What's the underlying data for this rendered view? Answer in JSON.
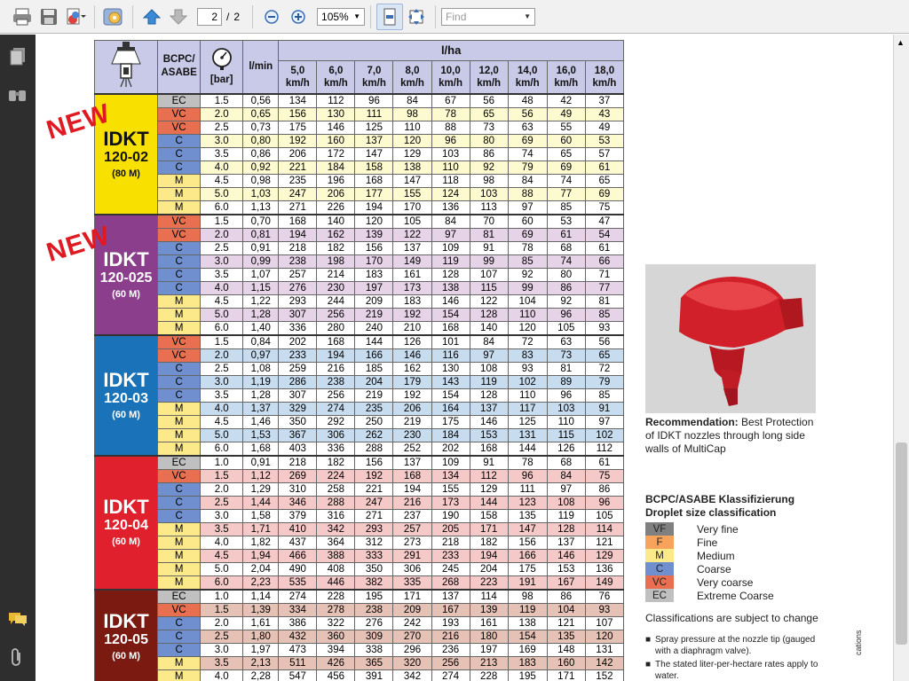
{
  "toolbar": {
    "page_current": "2",
    "page_sep": "/",
    "page_total": "2",
    "zoom": "105%",
    "find_placeholder": "Find"
  },
  "table": {
    "header_lha": "l/ha",
    "col_class": "BCPC/ ASABE",
    "col_bar": "[bar]",
    "col_lmin": "l/min",
    "speeds": [
      [
        "5,0",
        "km/h"
      ],
      [
        "6,0",
        "km/h"
      ],
      [
        "7,0",
        "km/h"
      ],
      [
        "8,0",
        "km/h"
      ],
      [
        "10,0",
        "km/h"
      ],
      [
        "12,0",
        "km/h"
      ],
      [
        "14,0",
        "km/h"
      ],
      [
        "16,0",
        "km/h"
      ],
      [
        "18,0",
        "km/h"
      ]
    ],
    "groups": [
      {
        "name1": "IDKT",
        "name2": "120-02",
        "name3": "(80 M)",
        "color": "#f8e000",
        "textcolor": "#111",
        "rowcolor": "#fdfad0",
        "rows": [
          [
            "EC",
            "1.5",
            "0,56",
            "134",
            "112",
            "96",
            "84",
            "67",
            "56",
            "48",
            "42",
            "37"
          ],
          [
            "VC",
            "2.0",
            "0,65",
            "156",
            "130",
            "111",
            "98",
            "78",
            "65",
            "56",
            "49",
            "43"
          ],
          [
            "VC",
            "2.5",
            "0,73",
            "175",
            "146",
            "125",
            "110",
            "88",
            "73",
            "63",
            "55",
            "49"
          ],
          [
            "C",
            "3.0",
            "0,80",
            "192",
            "160",
            "137",
            "120",
            "96",
            "80",
            "69",
            "60",
            "53"
          ],
          [
            "C",
            "3.5",
            "0,86",
            "206",
            "172",
            "147",
            "129",
            "103",
            "86",
            "74",
            "65",
            "57"
          ],
          [
            "C",
            "4.0",
            "0,92",
            "221",
            "184",
            "158",
            "138",
            "110",
            "92",
            "79",
            "69",
            "61"
          ],
          [
            "M",
            "4.5",
            "0,98",
            "235",
            "196",
            "168",
            "147",
            "118",
            "98",
            "84",
            "74",
            "65"
          ],
          [
            "M",
            "5.0",
            "1,03",
            "247",
            "206",
            "177",
            "155",
            "124",
            "103",
            "88",
            "77",
            "69"
          ],
          [
            "M",
            "6.0",
            "1,13",
            "271",
            "226",
            "194",
            "170",
            "136",
            "113",
            "97",
            "85",
            "75"
          ]
        ]
      },
      {
        "name1": "IDKT",
        "name2": "120-025",
        "name3": "(60 M)",
        "color": "#8b3e8c",
        "textcolor": "#fff",
        "rowcolor": "#e7d3e7",
        "rows": [
          [
            "VC",
            "1.5",
            "0,70",
            "168",
            "140",
            "120",
            "105",
            "84",
            "70",
            "60",
            "53",
            "47"
          ],
          [
            "VC",
            "2.0",
            "0,81",
            "194",
            "162",
            "139",
            "122",
            "97",
            "81",
            "69",
            "61",
            "54"
          ],
          [
            "C",
            "2.5",
            "0,91",
            "218",
            "182",
            "156",
            "137",
            "109",
            "91",
            "78",
            "68",
            "61"
          ],
          [
            "C",
            "3.0",
            "0,99",
            "238",
            "198",
            "170",
            "149",
            "119",
            "99",
            "85",
            "74",
            "66"
          ],
          [
            "C",
            "3.5",
            "1,07",
            "257",
            "214",
            "183",
            "161",
            "128",
            "107",
            "92",
            "80",
            "71"
          ],
          [
            "C",
            "4.0",
            "1,15",
            "276",
            "230",
            "197",
            "173",
            "138",
            "115",
            "99",
            "86",
            "77"
          ],
          [
            "M",
            "4.5",
            "1,22",
            "293",
            "244",
            "209",
            "183",
            "146",
            "122",
            "104",
            "92",
            "81"
          ],
          [
            "M",
            "5.0",
            "1,28",
            "307",
            "256",
            "219",
            "192",
            "154",
            "128",
            "110",
            "96",
            "85"
          ],
          [
            "M",
            "6.0",
            "1,40",
            "336",
            "280",
            "240",
            "210",
            "168",
            "140",
            "120",
            "105",
            "93"
          ]
        ]
      },
      {
        "name1": "IDKT",
        "name2": "120-03",
        "name3": "(60 M)",
        "color": "#1a73b8",
        "textcolor": "#fff",
        "rowcolor": "#c8dcf0",
        "rows": [
          [
            "VC",
            "1.5",
            "0,84",
            "202",
            "168",
            "144",
            "126",
            "101",
            "84",
            "72",
            "63",
            "56"
          ],
          [
            "VC",
            "2.0",
            "0,97",
            "233",
            "194",
            "166",
            "146",
            "116",
            "97",
            "83",
            "73",
            "65"
          ],
          [
            "C",
            "2.5",
            "1,08",
            "259",
            "216",
            "185",
            "162",
            "130",
            "108",
            "93",
            "81",
            "72"
          ],
          [
            "C",
            "3.0",
            "1,19",
            "286",
            "238",
            "204",
            "179",
            "143",
            "119",
            "102",
            "89",
            "79"
          ],
          [
            "C",
            "3.5",
            "1,28",
            "307",
            "256",
            "219",
            "192",
            "154",
            "128",
            "110",
            "96",
            "85"
          ],
          [
            "M",
            "4.0",
            "1,37",
            "329",
            "274",
            "235",
            "206",
            "164",
            "137",
            "117",
            "103",
            "91"
          ],
          [
            "M",
            "4.5",
            "1,46",
            "350",
            "292",
            "250",
            "219",
            "175",
            "146",
            "125",
            "110",
            "97"
          ],
          [
            "M",
            "5.0",
            "1,53",
            "367",
            "306",
            "262",
            "230",
            "184",
            "153",
            "131",
            "115",
            "102"
          ],
          [
            "M",
            "6.0",
            "1,68",
            "403",
            "336",
            "288",
            "252",
            "202",
            "168",
            "144",
            "126",
            "112"
          ]
        ]
      },
      {
        "name1": "IDKT",
        "name2": "120-04",
        "name3": "(60 M)",
        "color": "#e0202c",
        "textcolor": "#fff",
        "rowcolor": "#f6c9c9",
        "rows": [
          [
            "EC",
            "1.0",
            "0,91",
            "218",
            "182",
            "156",
            "137",
            "109",
            "91",
            "78",
            "68",
            "61"
          ],
          [
            "VC",
            "1.5",
            "1,12",
            "269",
            "224",
            "192",
            "168",
            "134",
            "112",
            "96",
            "84",
            "75"
          ],
          [
            "C",
            "2.0",
            "1,29",
            "310",
            "258",
            "221",
            "194",
            "155",
            "129",
            "111",
            "97",
            "86"
          ],
          [
            "C",
            "2.5",
            "1,44",
            "346",
            "288",
            "247",
            "216",
            "173",
            "144",
            "123",
            "108",
            "96"
          ],
          [
            "C",
            "3.0",
            "1,58",
            "379",
            "316",
            "271",
            "237",
            "190",
            "158",
            "135",
            "119",
            "105"
          ],
          [
            "M",
            "3.5",
            "1,71",
            "410",
            "342",
            "293",
            "257",
            "205",
            "171",
            "147",
            "128",
            "114"
          ],
          [
            "M",
            "4.0",
            "1,82",
            "437",
            "364",
            "312",
            "273",
            "218",
            "182",
            "156",
            "137",
            "121"
          ],
          [
            "M",
            "4.5",
            "1,94",
            "466",
            "388",
            "333",
            "291",
            "233",
            "194",
            "166",
            "146",
            "129"
          ],
          [
            "M",
            "5.0",
            "2,04",
            "490",
            "408",
            "350",
            "306",
            "245",
            "204",
            "175",
            "153",
            "136"
          ],
          [
            "M",
            "6.0",
            "2,23",
            "535",
            "446",
            "382",
            "335",
            "268",
            "223",
            "191",
            "167",
            "149"
          ]
        ]
      },
      {
        "name1": "IDKT",
        "name2": "120-05",
        "name3": "(60 M)",
        "color": "#7a1a10",
        "textcolor": "#fff",
        "rowcolor": "#e6c2b6",
        "rows": [
          [
            "EC",
            "1.0",
            "1,14",
            "274",
            "228",
            "195",
            "171",
            "137",
            "114",
            "98",
            "86",
            "76"
          ],
          [
            "VC",
            "1.5",
            "1,39",
            "334",
            "278",
            "238",
            "209",
            "167",
            "139",
            "119",
            "104",
            "93"
          ],
          [
            "C",
            "2.0",
            "1,61",
            "386",
            "322",
            "276",
            "242",
            "193",
            "161",
            "138",
            "121",
            "107"
          ],
          [
            "C",
            "2.5",
            "1,80",
            "432",
            "360",
            "309",
            "270",
            "216",
            "180",
            "154",
            "135",
            "120"
          ],
          [
            "C",
            "3.0",
            "1,97",
            "473",
            "394",
            "338",
            "296",
            "236",
            "197",
            "169",
            "148",
            "131"
          ],
          [
            "M",
            "3.5",
            "2,13",
            "511",
            "426",
            "365",
            "320",
            "256",
            "213",
            "183",
            "160",
            "142"
          ],
          [
            "M",
            "4.0",
            "2,28",
            "547",
            "456",
            "391",
            "342",
            "274",
            "228",
            "195",
            "171",
            "152"
          ]
        ]
      }
    ]
  },
  "class_colors": {
    "VF": "#808080",
    "F": "#f7a35c",
    "M": "#fbe98a",
    "C": "#6f8fcf",
    "VC": "#e87050",
    "EC": "#c0c0c0"
  },
  "new_label": "NEW",
  "recommendation": {
    "bold": "Recommendation:",
    "text": " Best Protection of IDKT nozzles through long side walls of MultiCap"
  },
  "legend": {
    "title1": "BCPC/ASABE Klassifizierung",
    "title2": "Droplet size classification",
    "items": [
      {
        "code": "VF",
        "label": "Very fine"
      },
      {
        "code": "F",
        "label": "Fine"
      },
      {
        "code": "M",
        "label": "Medium"
      },
      {
        "code": "C",
        "label": "Coarse"
      },
      {
        "code": "VC",
        "label": "Very coarse"
      },
      {
        "code": "EC",
        "label": "Extreme Coarse"
      }
    ],
    "note": "Classifications are subject to change",
    "bullets": [
      "Spray pressure at the nozzle tip (gauged with a diaphragm valve).",
      "The stated liter-per-hectare rates apply to water."
    ]
  },
  "side_text": "cations"
}
